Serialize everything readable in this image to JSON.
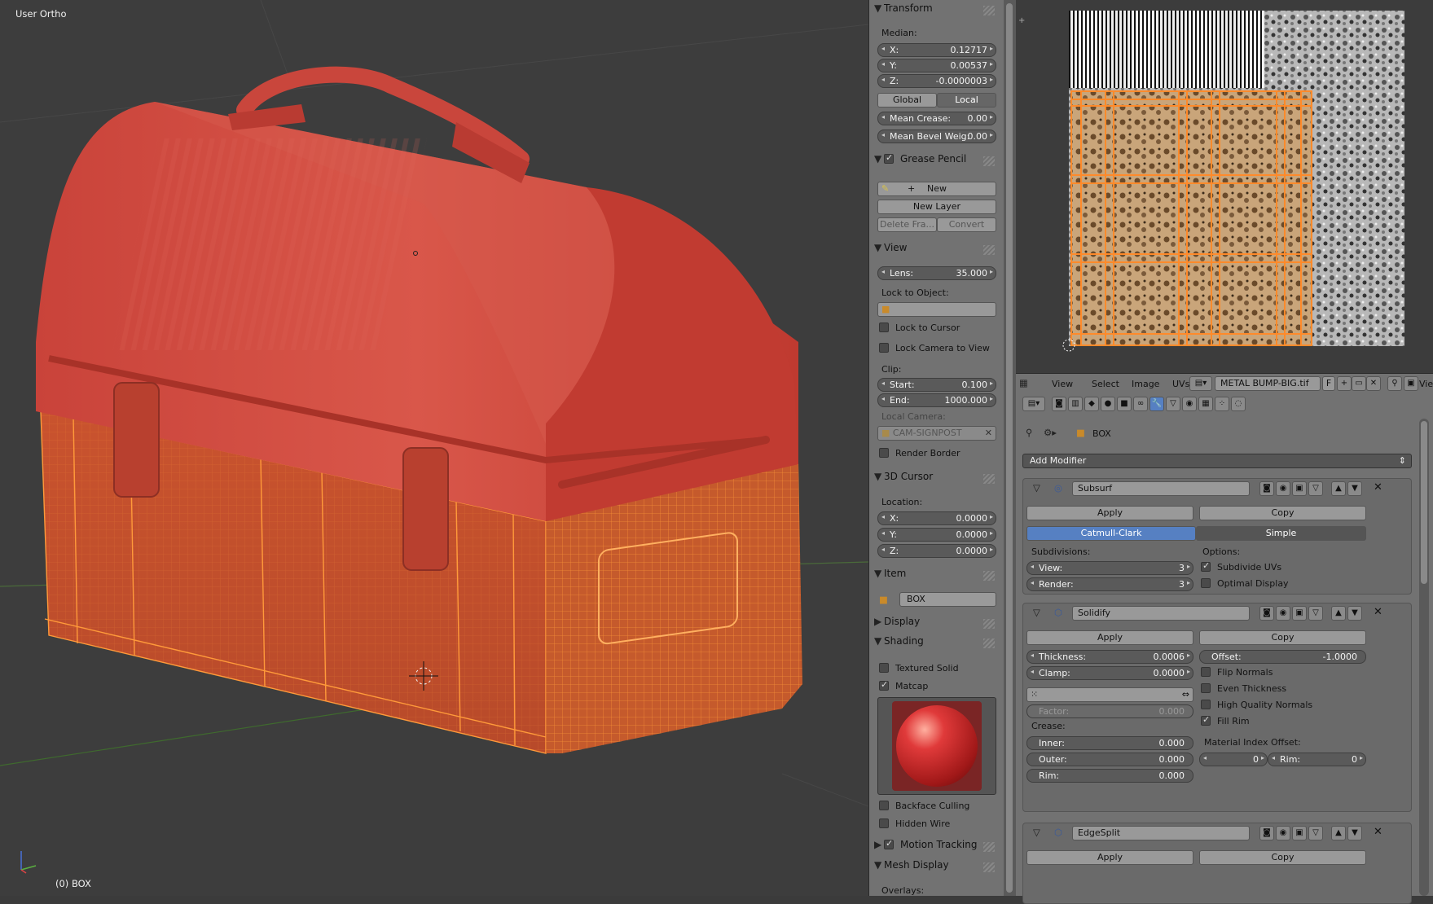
{
  "viewport": {
    "view_label": "User Ortho",
    "object_label": "(0) BOX"
  },
  "npanel": {
    "transform": {
      "title": "Transform",
      "median_label": "Median:",
      "x": {
        "label": "X:",
        "value": "0.12717"
      },
      "y": {
        "label": "Y:",
        "value": "0.00537"
      },
      "z": {
        "label": "Z:",
        "value": "-0.0000003"
      },
      "global_btn": "Global",
      "local_btn": "Local",
      "mean_crease": {
        "label": "Mean Crease:",
        "value": "0.00"
      },
      "mean_bevel": {
        "label": "Mean Bevel Weig:",
        "value": "0.00"
      }
    },
    "grease": {
      "title": "Grease Pencil",
      "new_btn": "New",
      "new_layer_btn": "New Layer",
      "delete_btn": "Delete Fra...",
      "convert_btn": "Convert"
    },
    "view": {
      "title": "View",
      "lens": {
        "label": "Lens:",
        "value": "35.000"
      },
      "lock_obj_label": "Lock to Object:",
      "lock_cursor": "Lock to Cursor",
      "lock_camera": "Lock Camera to View",
      "clip_label": "Clip:",
      "start": {
        "label": "Start:",
        "value": "0.100"
      },
      "end": {
        "label": "End:",
        "value": "1000.000"
      },
      "local_camera_label": "Local Camera:",
      "camera_name": "CAM-SIGNPOST",
      "render_border": "Render Border"
    },
    "cursor": {
      "title": "3D Cursor",
      "location_label": "Location:",
      "x": {
        "label": "X:",
        "value": "0.0000"
      },
      "y": {
        "label": "Y:",
        "value": "0.0000"
      },
      "z": {
        "label": "Z:",
        "value": "0.0000"
      }
    },
    "item": {
      "title": "Item",
      "name": "BOX"
    },
    "display": {
      "title": "Display"
    },
    "shading": {
      "title": "Shading",
      "textured_solid": "Textured Solid",
      "matcap": "Matcap",
      "backface": "Backface Culling",
      "hidden_wire": "Hidden Wire"
    },
    "motion": {
      "title": "Motion Tracking"
    },
    "mesh_display": {
      "title": "Mesh Display",
      "overlays_label": "Overlays:"
    }
  },
  "uv_header": {
    "menus": [
      "View",
      "Select",
      "Image",
      "UVs"
    ],
    "image_name": "METAL BUMP-BIG.tif",
    "f_label": "F",
    "view_trunc": "Vie"
  },
  "props": {
    "object_name": "BOX",
    "add_modifier": "Add Modifier",
    "subsurf": {
      "name": "Subsurf",
      "apply": "Apply",
      "copy": "Copy",
      "catmull": "Catmull-Clark",
      "simple": "Simple",
      "subdivisions_label": "Subdivisions:",
      "view": {
        "label": "View:",
        "value": "3"
      },
      "render": {
        "label": "Render:",
        "value": "3"
      },
      "options_label": "Options:",
      "subdivide_uvs": "Subdivide UVs",
      "optimal_display": "Optimal Display"
    },
    "solidify": {
      "name": "Solidify",
      "apply": "Apply",
      "copy": "Copy",
      "thickness": {
        "label": "Thickness:",
        "value": "0.0006"
      },
      "offset": {
        "label": "Offset:",
        "value": "-1.0000"
      },
      "clamp": {
        "label": "Clamp:",
        "value": "0.0000"
      },
      "flip_normals": "Flip Normals",
      "even_thickness": "Even Thickness",
      "high_quality": "High Quality Normals",
      "fill_rim": "Fill Rim",
      "factor": {
        "label": "Factor:",
        "value": "0.000"
      },
      "crease_label": "Crease:",
      "inner": {
        "label": "Inner:",
        "value": "0.000"
      },
      "outer": {
        "label": "Outer:",
        "value": "0.000"
      },
      "rim": {
        "label": "Rim:",
        "value": "0.000"
      },
      "mat_index_label": "Material Index Offset:",
      "mat_index": "0",
      "mat_rim": {
        "label": "Rim:",
        "value": "0"
      }
    },
    "edgesplit": {
      "name": "EdgeSplit",
      "apply": "Apply",
      "copy": "Copy"
    }
  }
}
